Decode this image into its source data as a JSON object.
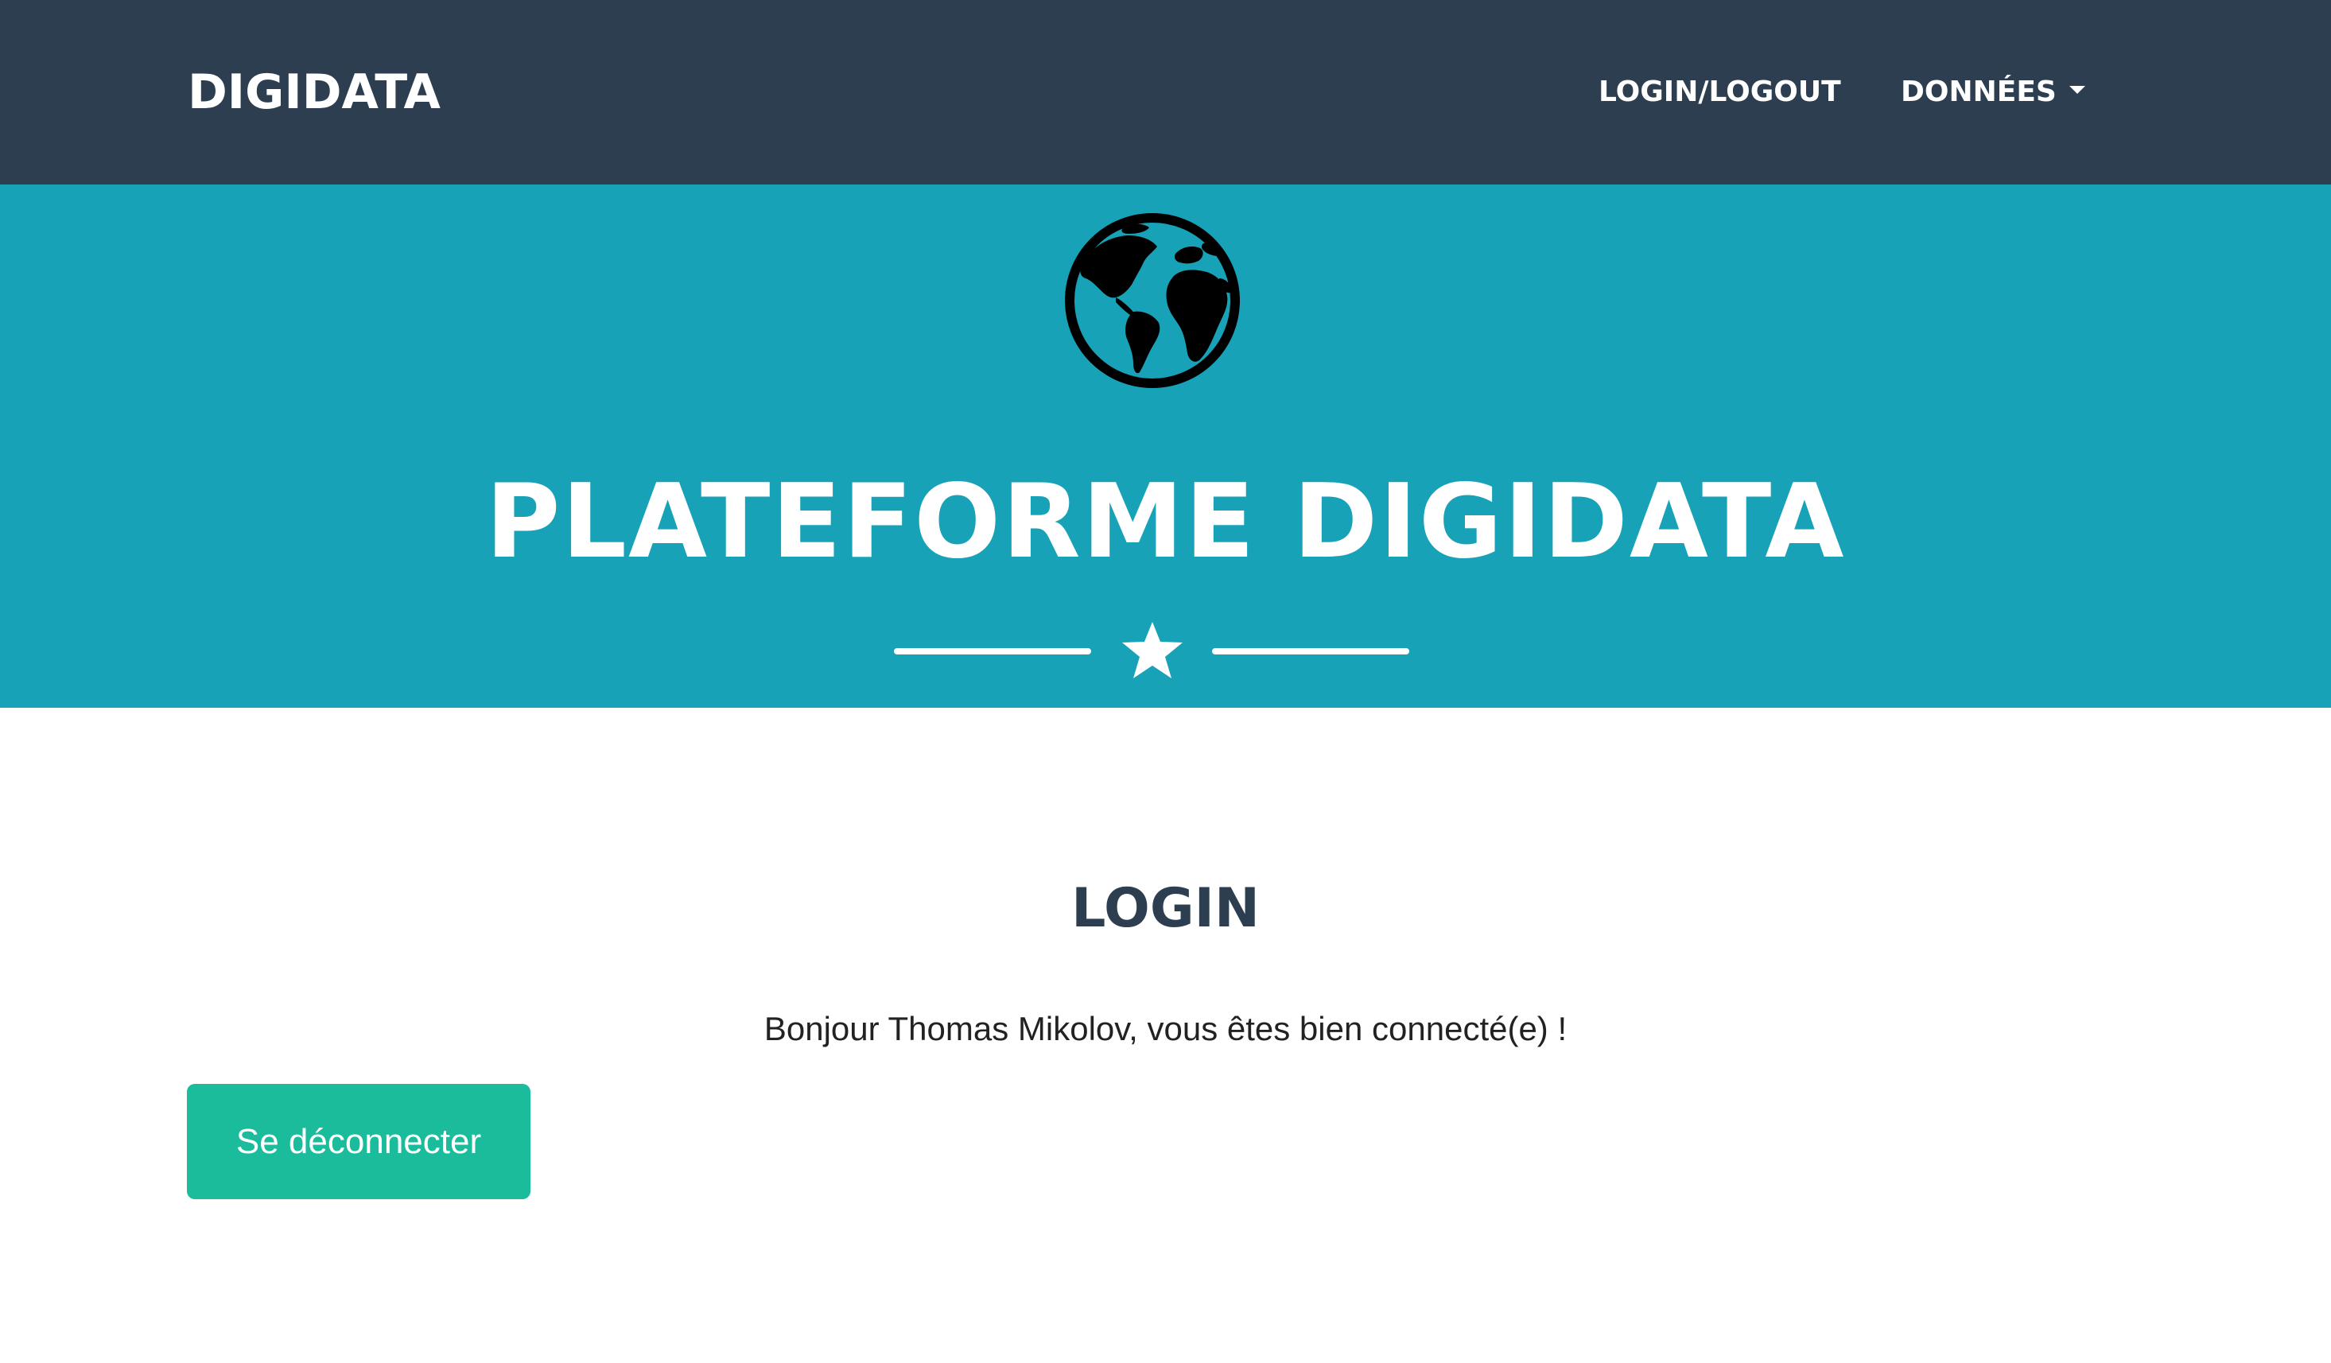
{
  "navbar": {
    "brand": "DIGIDATA",
    "links": [
      {
        "label": "LOGIN/LOGOUT"
      },
      {
        "label": "DONNÉES",
        "icon": "caret-down-icon"
      }
    ]
  },
  "masthead": {
    "icon": "globe-icon",
    "title": "PLATEFORME DIGIDATA",
    "divider_icon": "star-icon"
  },
  "login": {
    "title": "LOGIN",
    "welcome": "Bonjour Thomas Mikolov, vous êtes bien connecté(e) !",
    "logout_label": "Se déconnecter"
  },
  "colors": {
    "navbar": "#2c3e50",
    "masthead": "#18a2b8",
    "button": "#1abc9c",
    "heading": "#2c3e50"
  }
}
